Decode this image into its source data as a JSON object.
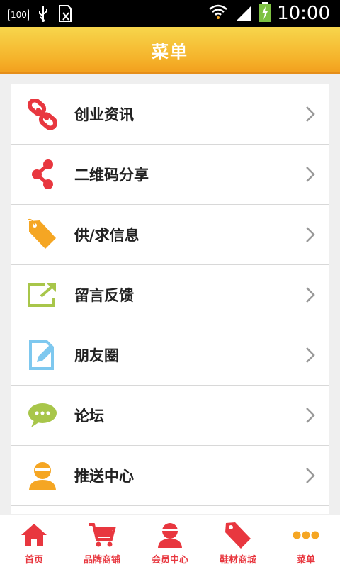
{
  "status_bar": {
    "battery_badge": "100",
    "time": "10:00"
  },
  "header": {
    "title": "菜单"
  },
  "menu": {
    "items": [
      {
        "label": "创业资讯",
        "icon": "link-icon"
      },
      {
        "label": "二维码分享",
        "icon": "share-icon"
      },
      {
        "label": "供/求信息",
        "icon": "sale-tag-icon"
      },
      {
        "label": "留言反馈",
        "icon": "export-icon"
      },
      {
        "label": "朋友圈",
        "icon": "edit-icon"
      },
      {
        "label": "论坛",
        "icon": "chat-bubble-icon"
      },
      {
        "label": "推送中心",
        "icon": "user-icon"
      }
    ]
  },
  "tabbar": {
    "items": [
      {
        "label": "首页",
        "icon": "home-icon"
      },
      {
        "label": "品牌商铺",
        "icon": "cart-icon"
      },
      {
        "label": "会员中心",
        "icon": "member-icon"
      },
      {
        "label": "鞋材商城",
        "icon": "sale-tag-icon"
      },
      {
        "label": "菜单",
        "icon": "more-dots-icon"
      }
    ]
  },
  "colors": {
    "accent_red": "#e8373f",
    "header_yellow": "#f5b32b",
    "icon_orange": "#f5a623",
    "icon_green": "#a8c64a",
    "icon_blue": "#7ec8ef"
  }
}
